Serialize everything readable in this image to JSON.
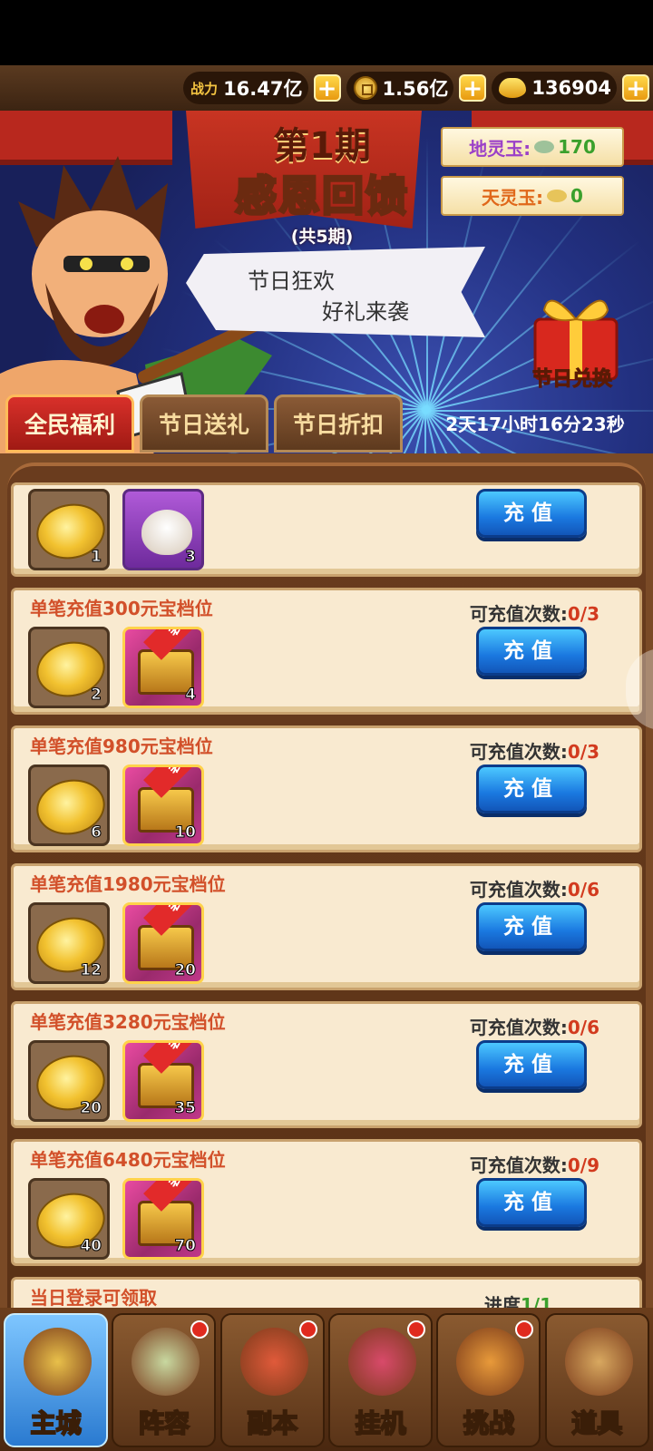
{
  "resources": {
    "power_label": "战力",
    "power_value": "16.47亿",
    "coins_value": "1.56亿",
    "ingots_value": "136904"
  },
  "banner": {
    "period": "第1期",
    "title": "感恩回馈",
    "subtitle": "(共5期)",
    "slogan_line1": "节日狂欢",
    "slogan_line2": "好礼来袭",
    "earth_jade_label": "地灵玉:",
    "earth_jade_value": "170",
    "sky_jade_label": "天灵玉:",
    "sky_jade_value": "0",
    "gift_label": "节日兑换",
    "timer": "2天17小时16分23秒"
  },
  "tabs": [
    "全民福利",
    "节日送礼",
    "节日折扣"
  ],
  "recharge_button": "充值",
  "cards": [
    {
      "title": "",
      "count_label": "",
      "count": "",
      "items": [
        {
          "type": "coin",
          "qty": "1"
        },
        {
          "type": "bun",
          "qty": "3"
        }
      ]
    },
    {
      "title": "单笔充值300元宝档位",
      "count_label": "可充值次数:",
      "count": "0/3",
      "items": [
        {
          "type": "coin",
          "qty": "2"
        },
        {
          "type": "chest",
          "qty": "4",
          "tag": "装备"
        }
      ]
    },
    {
      "title": "单笔充值980元宝档位",
      "count_label": "可充值次数:",
      "count": "0/3",
      "items": [
        {
          "type": "coin",
          "qty": "6"
        },
        {
          "type": "chest",
          "qty": "10",
          "tag": "装备"
        }
      ]
    },
    {
      "title": "单笔充值1980元宝档位",
      "count_label": "可充值次数:",
      "count": "0/6",
      "items": [
        {
          "type": "coin",
          "qty": "12"
        },
        {
          "type": "chest",
          "qty": "20",
          "tag": "装备"
        }
      ]
    },
    {
      "title": "单笔充值3280元宝档位",
      "count_label": "可充值次数:",
      "count": "0/6",
      "items": [
        {
          "type": "coin",
          "qty": "20"
        },
        {
          "type": "chest",
          "qty": "35",
          "tag": "装备"
        }
      ]
    },
    {
      "title": "单笔充值6480元宝档位",
      "count_label": "可充值次数:",
      "count": "0/9",
      "items": [
        {
          "type": "coin",
          "qty": "40"
        },
        {
          "type": "chest",
          "qty": "70",
          "tag": "装备"
        }
      ]
    }
  ],
  "login_card": {
    "title": "当日登录可领取",
    "progress_label": "进度",
    "progress": "1/1"
  },
  "nav": [
    {
      "label": "主城",
      "icon": "palace-icon",
      "badge": false
    },
    {
      "label": "阵容",
      "icon": "team-icon",
      "badge": true
    },
    {
      "label": "副本",
      "icon": "dungeon-icon",
      "badge": true
    },
    {
      "label": "挂机",
      "icon": "idle-icon",
      "badge": true
    },
    {
      "label": "挑战",
      "icon": "challenge-icon",
      "badge": true
    },
    {
      "label": "道具",
      "icon": "items-icon",
      "badge": false
    }
  ]
}
